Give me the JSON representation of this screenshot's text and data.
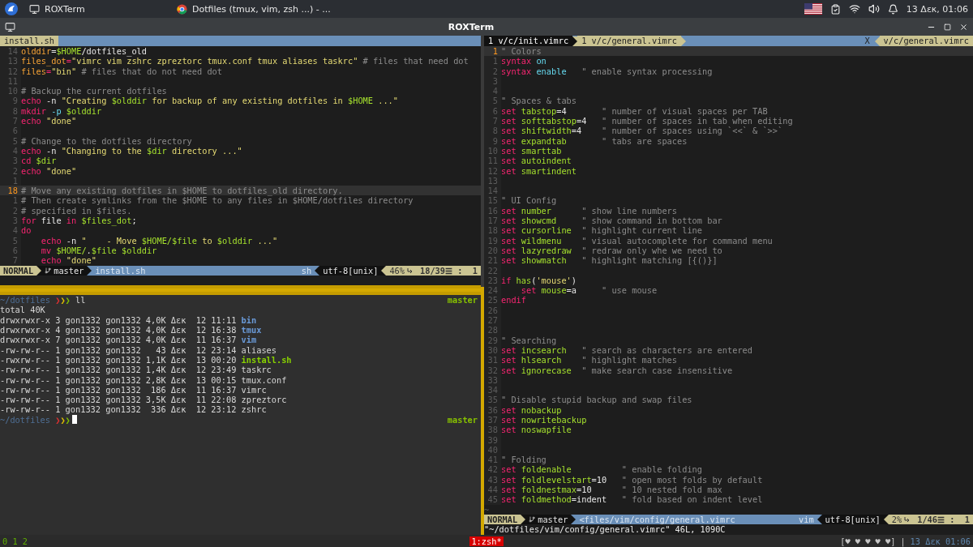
{
  "taskbar": {
    "windows": [
      {
        "label": "ROXTerm",
        "kind": "terminal"
      },
      {
        "label": "Dotfiles (tmux, vim, zsh ...) - ...",
        "kind": "browser"
      }
    ],
    "clock": "13 Δεκ, 01:06"
  },
  "window": {
    "title": "ROXTerm"
  },
  "left_editor": {
    "tab": "install.sh",
    "lines": [
      {
        "number": "14",
        "current": false,
        "tokens": [
          {
            "kind": "identifier",
            "text": "olddir"
          },
          {
            "kind": "plain",
            "text": "="
          },
          {
            "kind": "variable",
            "text": "$HOME"
          },
          {
            "kind": "plain",
            "text": "/dotfiles_old"
          }
        ]
      },
      {
        "number": "13",
        "current": false,
        "tokens": [
          {
            "kind": "identifier",
            "text": "files_dot"
          },
          {
            "kind": "keyword",
            "text": "="
          },
          {
            "kind": "string",
            "text": "\"vimrc vim zshrc zpreztorc tmux.conf tmux aliases taskrc\""
          },
          {
            "kind": "comment",
            "text": " # files that need dot"
          }
        ]
      },
      {
        "number": "12",
        "current": false,
        "tokens": [
          {
            "kind": "identifier",
            "text": "files"
          },
          {
            "kind": "keyword",
            "text": "="
          },
          {
            "kind": "string",
            "text": "\"bin\""
          },
          {
            "kind": "comment",
            "text": " # files that do not need dot"
          }
        ]
      },
      {
        "number": "11",
        "current": false
      },
      {
        "number": "10",
        "current": false,
        "tokens": [
          {
            "kind": "comment",
            "text": "# Backup the current dotfiles"
          }
        ]
      },
      {
        "number": "9",
        "current": false,
        "tokens": [
          {
            "kind": "keyword",
            "text": "echo"
          },
          {
            "kind": "plain",
            "text": " -n "
          },
          {
            "kind": "string",
            "text": "\"Creating "
          },
          {
            "kind": "variable",
            "text": "$olddir"
          },
          {
            "kind": "string",
            "text": " for backup of any existing dotfiles in "
          },
          {
            "kind": "variable",
            "text": "$HOME"
          },
          {
            "kind": "string",
            "text": " ...\""
          }
        ]
      },
      {
        "number": "8",
        "current": false,
        "tokens": [
          {
            "kind": "keyword",
            "text": "mkdir"
          },
          {
            "kind": "option",
            "text": " -p "
          },
          {
            "kind": "variable",
            "text": "$olddir"
          }
        ]
      },
      {
        "number": "7",
        "current": false,
        "tokens": [
          {
            "kind": "keyword",
            "text": "echo"
          },
          {
            "kind": "string",
            "text": " \"done\""
          }
        ]
      },
      {
        "number": "6",
        "current": false
      },
      {
        "number": "5",
        "current": false,
        "tokens": [
          {
            "kind": "comment",
            "text": "# Change to the dotfiles directory"
          }
        ]
      },
      {
        "number": "4",
        "current": false,
        "tokens": [
          {
            "kind": "keyword",
            "text": "echo"
          },
          {
            "kind": "plain",
            "text": " -n "
          },
          {
            "kind": "string",
            "text": "\"Changing to the "
          },
          {
            "kind": "variable",
            "text": "$dir"
          },
          {
            "kind": "string",
            "text": " directory ...\""
          }
        ]
      },
      {
        "number": "3",
        "current": false,
        "tokens": [
          {
            "kind": "keyword",
            "text": "cd"
          },
          {
            "kind": "variable",
            "text": " $dir"
          }
        ]
      },
      {
        "number": "2",
        "current": false,
        "tokens": [
          {
            "kind": "keyword",
            "text": "echo"
          },
          {
            "kind": "string",
            "text": " \"done\""
          }
        ]
      },
      {
        "number": "1",
        "current": false
      },
      {
        "number": "18",
        "current": true,
        "tokens": [
          {
            "kind": "comment",
            "text": "# Move any existing dotfiles in $HOME to dotfiles_old directory."
          }
        ]
      },
      {
        "number": "1",
        "current": false,
        "tokens": [
          {
            "kind": "comment",
            "text": "# Then create symlinks from the $HOME to any files in $HOME/dotfiles directory"
          }
        ]
      },
      {
        "number": "2",
        "current": false,
        "tokens": [
          {
            "kind": "comment",
            "text": "# specified in $files."
          }
        ]
      },
      {
        "number": "3",
        "current": false,
        "tokens": [
          {
            "kind": "keyword",
            "text": "for"
          },
          {
            "kind": "plain",
            "text": " file "
          },
          {
            "kind": "keyword",
            "text": "in"
          },
          {
            "kind": "variable",
            "text": " $files_dot"
          },
          {
            "kind": "plain",
            "text": ";"
          }
        ]
      },
      {
        "number": "4",
        "current": false,
        "tokens": [
          {
            "kind": "keyword",
            "text": "do"
          }
        ]
      },
      {
        "number": "5",
        "current": false,
        "tokens": [
          {
            "kind": "keyword",
            "text": "    echo"
          },
          {
            "kind": "plain",
            "text": " -n "
          },
          {
            "kind": "string",
            "text": "\"    - Move "
          },
          {
            "kind": "variable",
            "text": "$HOME/$file"
          },
          {
            "kind": "string",
            "text": " to "
          },
          {
            "kind": "variable",
            "text": "$olddir"
          },
          {
            "kind": "string",
            "text": " ...\""
          }
        ]
      },
      {
        "number": "6",
        "current": false,
        "tokens": [
          {
            "kind": "keyword",
            "text": "    mv"
          },
          {
            "kind": "variable",
            "text": " $HOME/"
          },
          {
            "kind": "plain",
            "text": "."
          },
          {
            "kind": "variable",
            "text": "$file $olddir"
          }
        ]
      },
      {
        "number": "7",
        "current": false,
        "tokens": [
          {
            "kind": "keyword",
            "text": "    echo"
          },
          {
            "kind": "string",
            "text": " \"done\""
          }
        ]
      }
    ],
    "status": {
      "mode": "NORMAL",
      "branch": "master",
      "file": "install.sh",
      "filetype": "sh",
      "encoding": "utf-8[unix]",
      "percent": "46%",
      "position": "18/39☰ :  1"
    }
  },
  "terminal": {
    "lines": [
      {
        "kind": "prompt",
        "path": "~/dotfiles",
        "arrows": "❯❯❯",
        "command": "ll",
        "branch": "master",
        "cursor": false
      },
      {
        "kind": "output",
        "text": "total 40K"
      },
      {
        "kind": "entry",
        "info": "drwxrwxr-x 3 gon1332 gon1332 4,0K Δεκ  12 11:11 ",
        "name": "bin",
        "color": "#6a9ad8",
        "bold": true
      },
      {
        "kind": "entry",
        "info": "drwxrwxr-x 4 gon1332 gon1332 4,0K Δεκ  12 16:38 ",
        "name": "tmux",
        "color": "#6a9ad8",
        "bold": true
      },
      {
        "kind": "entry",
        "info": "drwxrwxr-x 7 gon1332 gon1332 4,0K Δεκ  11 16:37 ",
        "name": "vim",
        "color": "#6a9ad8",
        "bold": true
      },
      {
        "kind": "entry",
        "info": "-rw-rw-r-- 1 gon1332 gon1332   43 Δεκ  12 23:14 ",
        "name": "aliases",
        "color": "#d8d8d8",
        "bold": false
      },
      {
        "kind": "entry",
        "info": "-rwxrw-r-- 1 gon1332 gon1332 1,1K Δεκ  13 00:20 ",
        "name": "install.sh",
        "color": "#87d000",
        "bold": true
      },
      {
        "kind": "entry",
        "info": "-rw-rw-r-- 1 gon1332 gon1332 1,4K Δεκ  12 23:49 ",
        "name": "taskrc",
        "color": "#d8d8d8",
        "bold": false
      },
      {
        "kind": "entry",
        "info": "-rw-rw-r-- 1 gon1332 gon1332 2,8K Δεκ  13 00:15 ",
        "name": "tmux.conf",
        "color": "#d8d8d8",
        "bold": false
      },
      {
        "kind": "entry",
        "info": "-rw-rw-r-- 1 gon1332 gon1332  186 Δεκ  11 16:37 ",
        "name": "vimrc",
        "color": "#d8d8d8",
        "bold": false
      },
      {
        "kind": "entry",
        "info": "-rw-rw-r-- 1 gon1332 gon1332 3,5K Δεκ  11 22:08 ",
        "name": "zpreztorc",
        "color": "#d8d8d8",
        "bold": false
      },
      {
        "kind": "entry",
        "info": "-rw-rw-r-- 1 gon1332 gon1332  336 Δεκ  12 23:12 ",
        "name": "zshrc",
        "color": "#d8d8d8",
        "bold": false
      },
      {
        "kind": "prompt",
        "path": "~/dotfiles",
        "arrows": "❯❯❯",
        "branch": "master",
        "cursor": true
      }
    ]
  },
  "right_editor": {
    "tabs": [
      {
        "label": "1 v/c/init.vimrc",
        "selected": true
      },
      {
        "label": "1 v/c/general.vimrc",
        "selected": false
      }
    ],
    "close": "X",
    "buffer": "v/c/general.vimrc",
    "lines": [
      {
        "number": "1",
        "current": true,
        "tokens": [
          {
            "kind": "comment",
            "text": "\" Colors"
          }
        ]
      },
      {
        "number": "1",
        "current": false,
        "tokens": [
          {
            "kind": "keyword",
            "text": "syntax"
          },
          {
            "kind": "option",
            "text": " on"
          }
        ]
      },
      {
        "number": "2",
        "current": false,
        "tokens": [
          {
            "kind": "keyword",
            "text": "syntax"
          },
          {
            "kind": "option",
            "text": " enable"
          },
          {
            "kind": "comment",
            "text": "   \" enable syntax processing"
          }
        ]
      },
      {
        "number": "3",
        "current": false
      },
      {
        "number": "4",
        "current": false
      },
      {
        "number": "5",
        "current": false,
        "tokens": [
          {
            "kind": "comment",
            "text": "\" Spaces & tabs"
          }
        ]
      },
      {
        "number": "6",
        "current": false,
        "tokens": [
          {
            "kind": "keyword",
            "text": "set"
          },
          {
            "kind": "variable",
            "text": " tabstop"
          },
          {
            "kind": "plain",
            "text": "=4"
          },
          {
            "kind": "comment",
            "text": "       \" number of visual spaces per TAB"
          }
        ]
      },
      {
        "number": "7",
        "current": false,
        "tokens": [
          {
            "kind": "keyword",
            "text": "set"
          },
          {
            "kind": "variable",
            "text": " softtabstop"
          },
          {
            "kind": "plain",
            "text": "=4"
          },
          {
            "kind": "comment",
            "text": "   \" number of spaces in tab when editing"
          }
        ]
      },
      {
        "number": "8",
        "current": false,
        "tokens": [
          {
            "kind": "keyword",
            "text": "set"
          },
          {
            "kind": "variable",
            "text": " shiftwidth"
          },
          {
            "kind": "plain",
            "text": "=4"
          },
          {
            "kind": "comment",
            "text": "    \" number of spaces using `<<` & `>>`"
          }
        ]
      },
      {
        "number": "9",
        "current": false,
        "tokens": [
          {
            "kind": "keyword",
            "text": "set"
          },
          {
            "kind": "variable",
            "text": " expandtab"
          },
          {
            "kind": "comment",
            "text": "       \" tabs are spaces"
          }
        ]
      },
      {
        "number": "10",
        "current": false,
        "tokens": [
          {
            "kind": "keyword",
            "text": "set"
          },
          {
            "kind": "variable",
            "text": " smarttab"
          }
        ]
      },
      {
        "number": "11",
        "current": false,
        "tokens": [
          {
            "kind": "keyword",
            "text": "set"
          },
          {
            "kind": "variable",
            "text": " autoindent"
          }
        ]
      },
      {
        "number": "12",
        "current": false,
        "tokens": [
          {
            "kind": "keyword",
            "text": "set"
          },
          {
            "kind": "variable",
            "text": " smartindent"
          }
        ]
      },
      {
        "number": "13",
        "current": false
      },
      {
        "number": "14",
        "current": false
      },
      {
        "number": "15",
        "current": false,
        "tokens": [
          {
            "kind": "comment",
            "text": "\" UI Config"
          }
        ]
      },
      {
        "number": "16",
        "current": false,
        "tokens": [
          {
            "kind": "keyword",
            "text": "set"
          },
          {
            "kind": "variable",
            "text": " number"
          },
          {
            "kind": "comment",
            "text": "      \" show line numbers"
          }
        ]
      },
      {
        "number": "17",
        "current": false,
        "tokens": [
          {
            "kind": "keyword",
            "text": "set"
          },
          {
            "kind": "variable",
            "text": " showcmd"
          },
          {
            "kind": "comment",
            "text": "     \" show command in bottom bar"
          }
        ]
      },
      {
        "number": "18",
        "current": false,
        "tokens": [
          {
            "kind": "keyword",
            "text": "set"
          },
          {
            "kind": "variable",
            "text": " cursorline"
          },
          {
            "kind": "comment",
            "text": "  \" highlight current line"
          }
        ]
      },
      {
        "number": "19",
        "current": false,
        "tokens": [
          {
            "kind": "keyword",
            "text": "set"
          },
          {
            "kind": "variable",
            "text": " wildmenu"
          },
          {
            "kind": "comment",
            "text": "    \" visual autocomplete for command menu"
          }
        ]
      },
      {
        "number": "20",
        "current": false,
        "tokens": [
          {
            "kind": "keyword",
            "text": "set"
          },
          {
            "kind": "variable",
            "text": " lazyredraw"
          },
          {
            "kind": "comment",
            "text": "  \" redraw only whe we need to"
          }
        ]
      },
      {
        "number": "21",
        "current": false,
        "tokens": [
          {
            "kind": "keyword",
            "text": "set"
          },
          {
            "kind": "variable",
            "text": " showmatch"
          },
          {
            "kind": "comment",
            "text": "   \" highlight matching [{()}]"
          }
        ]
      },
      {
        "number": "22",
        "current": false
      },
      {
        "number": "23",
        "current": false,
        "tokens": [
          {
            "kind": "keyword",
            "text": "if"
          },
          {
            "kind": "variable",
            "text": " has"
          },
          {
            "kind": "plain",
            "text": "("
          },
          {
            "kind": "string",
            "text": "'mouse'"
          },
          {
            "kind": "plain",
            "text": ")"
          }
        ]
      },
      {
        "number": "24",
        "current": false,
        "tokens": [
          {
            "kind": "keyword",
            "text": "    set"
          },
          {
            "kind": "variable",
            "text": " mouse"
          },
          {
            "kind": "plain",
            "text": "=a"
          },
          {
            "kind": "comment",
            "text": "     \" use mouse"
          }
        ]
      },
      {
        "number": "25",
        "current": false,
        "tokens": [
          {
            "kind": "keyword",
            "text": "endif"
          }
        ]
      },
      {
        "number": "26",
        "current": false
      },
      {
        "number": "27",
        "current": false
      },
      {
        "number": "28",
        "current": false
      },
      {
        "number": "29",
        "current": false,
        "tokens": [
          {
            "kind": "comment",
            "text": "\" Searching"
          }
        ]
      },
      {
        "number": "30",
        "current": false,
        "tokens": [
          {
            "kind": "keyword",
            "text": "set"
          },
          {
            "kind": "variable",
            "text": " incsearch"
          },
          {
            "kind": "comment",
            "text": "   \" search as characters are entered"
          }
        ]
      },
      {
        "number": "31",
        "current": false,
        "tokens": [
          {
            "kind": "keyword",
            "text": "set"
          },
          {
            "kind": "variable",
            "text": " hlsearch"
          },
          {
            "kind": "comment",
            "text": "    \" highlight matches"
          }
        ]
      },
      {
        "number": "32",
        "current": false,
        "tokens": [
          {
            "kind": "keyword",
            "text": "set"
          },
          {
            "kind": "variable",
            "text": " ignorecase"
          },
          {
            "kind": "comment",
            "text": "  \" make search case insensitive"
          }
        ]
      },
      {
        "number": "33",
        "current": false
      },
      {
        "number": "34",
        "current": false
      },
      {
        "number": "35",
        "current": false,
        "tokens": [
          {
            "kind": "comment",
            "text": "\" Disable stupid backup and swap files"
          }
        ]
      },
      {
        "number": "36",
        "current": false,
        "tokens": [
          {
            "kind": "keyword",
            "text": "set"
          },
          {
            "kind": "variable",
            "text": " nobackup"
          }
        ]
      },
      {
        "number": "37",
        "current": false,
        "tokens": [
          {
            "kind": "keyword",
            "text": "set"
          },
          {
            "kind": "variable",
            "text": " nowritebackup"
          }
        ]
      },
      {
        "number": "38",
        "current": false,
        "tokens": [
          {
            "kind": "keyword",
            "text": "set"
          },
          {
            "kind": "variable",
            "text": " noswapfile"
          }
        ]
      },
      {
        "number": "39",
        "current": false
      },
      {
        "number": "40",
        "current": false
      },
      {
        "number": "41",
        "current": false,
        "tokens": [
          {
            "kind": "comment",
            "text": "\" Folding"
          }
        ]
      },
      {
        "number": "42",
        "current": false,
        "tokens": [
          {
            "kind": "keyword",
            "text": "set"
          },
          {
            "kind": "variable",
            "text": " foldenable"
          },
          {
            "kind": "comment",
            "text": "          \" enable folding"
          }
        ]
      },
      {
        "number": "43",
        "current": false,
        "tokens": [
          {
            "kind": "keyword",
            "text": "set"
          },
          {
            "kind": "variable",
            "text": " foldlevelstart"
          },
          {
            "kind": "plain",
            "text": "=10"
          },
          {
            "kind": "comment",
            "text": "   \" open most folds by default"
          }
        ]
      },
      {
        "number": "44",
        "current": false,
        "tokens": [
          {
            "kind": "keyword",
            "text": "set"
          },
          {
            "kind": "variable",
            "text": " foldnestmax"
          },
          {
            "kind": "plain",
            "text": "=10"
          },
          {
            "kind": "comment",
            "text": "      \" 10 nested fold max"
          }
        ]
      },
      {
        "number": "45",
        "current": false,
        "tokens": [
          {
            "kind": "keyword",
            "text": "set"
          },
          {
            "kind": "variable",
            "text": " foldmethod"
          },
          {
            "kind": "plain",
            "text": "=indent"
          },
          {
            "kind": "comment",
            "text": "   \" fold based on indent level"
          }
        ]
      }
    ],
    "filler": "~",
    "status": {
      "mode": "NORMAL",
      "branch": "master",
      "file": "<files/vim/config/general.vimrc",
      "filetype": "vim",
      "encoding": "utf-8[unix]",
      "percent": "2%",
      "position": "1/46☰ :  1"
    },
    "message": "\"~/dotfiles/vim/config/general.vimrc\" 46L, 1090C"
  },
  "tmux_status": {
    "windows": "0 1 2",
    "active_window": "1:zsh*",
    "hearts": "[♥ ♥ ♥ ♥ ♥]",
    "separator": "|",
    "clock": "13 Δεκ 01:06"
  }
}
